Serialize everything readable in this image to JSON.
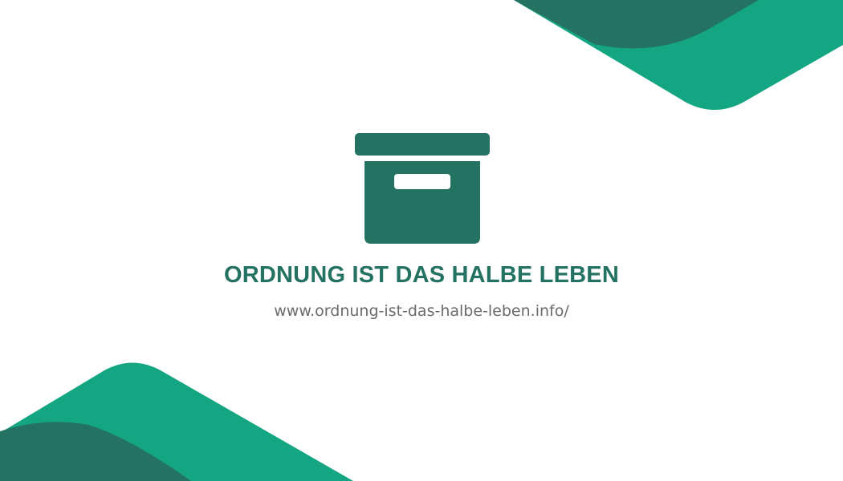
{
  "brand": {
    "title": "ORDNUNG IST DAS HALBE LEBEN",
    "url": "www.ordnung-ist-das-halbe-leben.info/",
    "logo_icon": "archive-box-icon"
  },
  "colors": {
    "dark_green": "#237262",
    "light_green": "#14a682",
    "url_gray": "#6b6b6b",
    "background": "#ffffff"
  }
}
